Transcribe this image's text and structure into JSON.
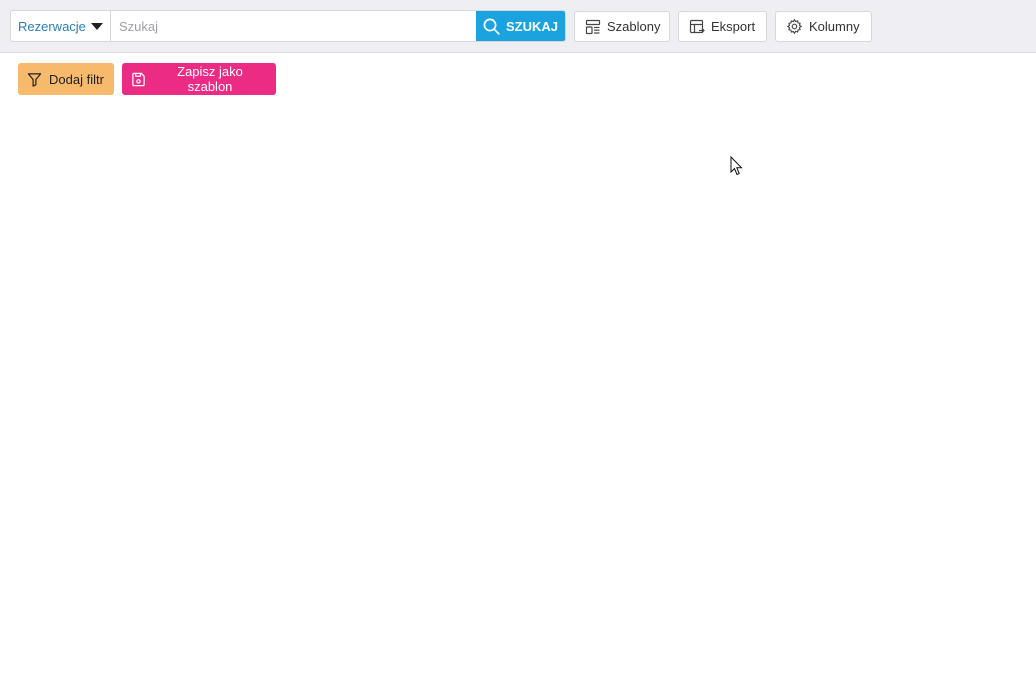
{
  "toolbar": {
    "scope_select": {
      "value": "Rezerwacje"
    },
    "search": {
      "placeholder": "Szukaj",
      "value": "",
      "button_label": "SZUKAJ"
    },
    "templates_label": "Szablony",
    "export_label": "Eksport",
    "columns_label": "Kolumny"
  },
  "actions": {
    "add_filter_label": "Dodaj filtr",
    "save_template_label": "Zapisz jako szablon"
  },
  "colors": {
    "search_button": "#1ba3e0",
    "add_filter": "#f7b96c",
    "save_template": "#ec2b85",
    "scope_text": "#2a7fb8"
  },
  "icons": {
    "search": "search-icon",
    "templates": "templates-icon",
    "export": "export-icon",
    "columns": "gear-icon",
    "filter": "filter-icon",
    "save": "save-icon"
  }
}
